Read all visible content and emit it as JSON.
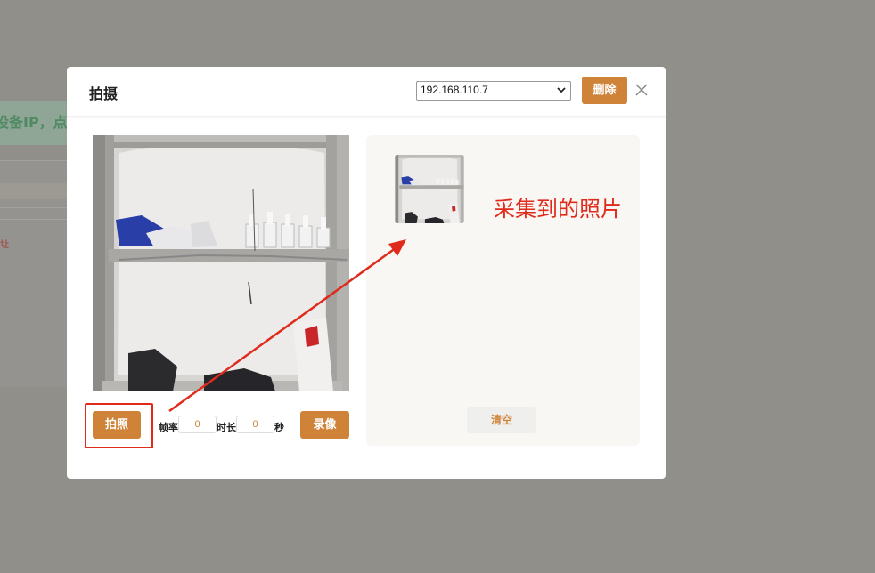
{
  "background": {
    "banner_text": "设备IP，点",
    "red_text": "址"
  },
  "modal": {
    "title": "拍摄",
    "ip_select": {
      "selected": "192.168.110.7"
    },
    "delete_label": "删除",
    "snap_label": "拍照",
    "frame_rate_label": "帧率",
    "frame_rate_value": "0",
    "duration_label": "时长",
    "duration_value": "0",
    "seconds_label": "秒",
    "record_label": "录像",
    "clear_label": "清空"
  },
  "annotation": {
    "text": "采集到的照片"
  },
  "colors": {
    "accent": "#cf8338",
    "annotation_red": "#e02b1c"
  },
  "icons": [
    "close-icon",
    "chevron-down-icon",
    "arrow-annotation"
  ]
}
